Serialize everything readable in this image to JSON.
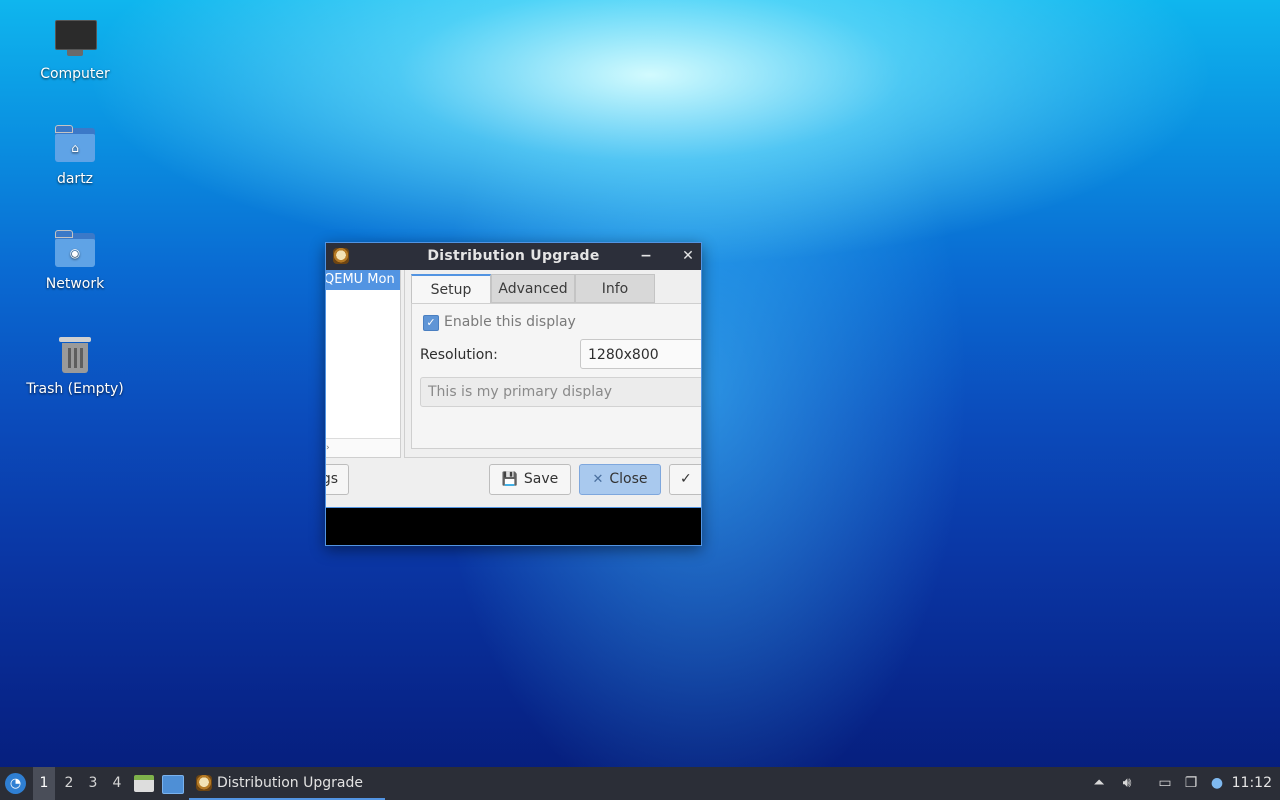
{
  "desktop": {
    "icons": [
      {
        "label": "Computer",
        "icon": "computer-icon"
      },
      {
        "label": "dartz",
        "icon": "home-folder-icon"
      },
      {
        "label": "Network",
        "icon": "network-folder-icon"
      },
      {
        "label": "Trash (Empty)",
        "icon": "trash-icon"
      }
    ]
  },
  "window": {
    "title": "Distribution Upgrade",
    "minimize_glyph": "−",
    "close_glyph": "✕",
    "display_list": {
      "selected_item": "QEMU Mon",
      "scroll_hint": "›"
    },
    "tabs": [
      {
        "label": "Setup",
        "active": true
      },
      {
        "label": "Advanced",
        "active": false
      },
      {
        "label": "Info",
        "active": false
      }
    ],
    "setup": {
      "enable_label": "Enable this display",
      "enable_checked": true,
      "resolution_label": "Resolution:",
      "resolution_value": "1280x800",
      "primary_label": "This is my primary display"
    },
    "buttons": {
      "left_partial": "gs",
      "save": "Save",
      "close": "Close",
      "apply_glyph": "✓"
    }
  },
  "taskbar": {
    "workspaces": [
      "1",
      "2",
      "3",
      "4"
    ],
    "active_workspace": "1",
    "task_label": "Distribution Upgrade",
    "clock": "11:12"
  },
  "colors": {
    "accent": "#5294e2",
    "titlebar": "#2c2f3a",
    "taskbar": "#2b2e37"
  }
}
